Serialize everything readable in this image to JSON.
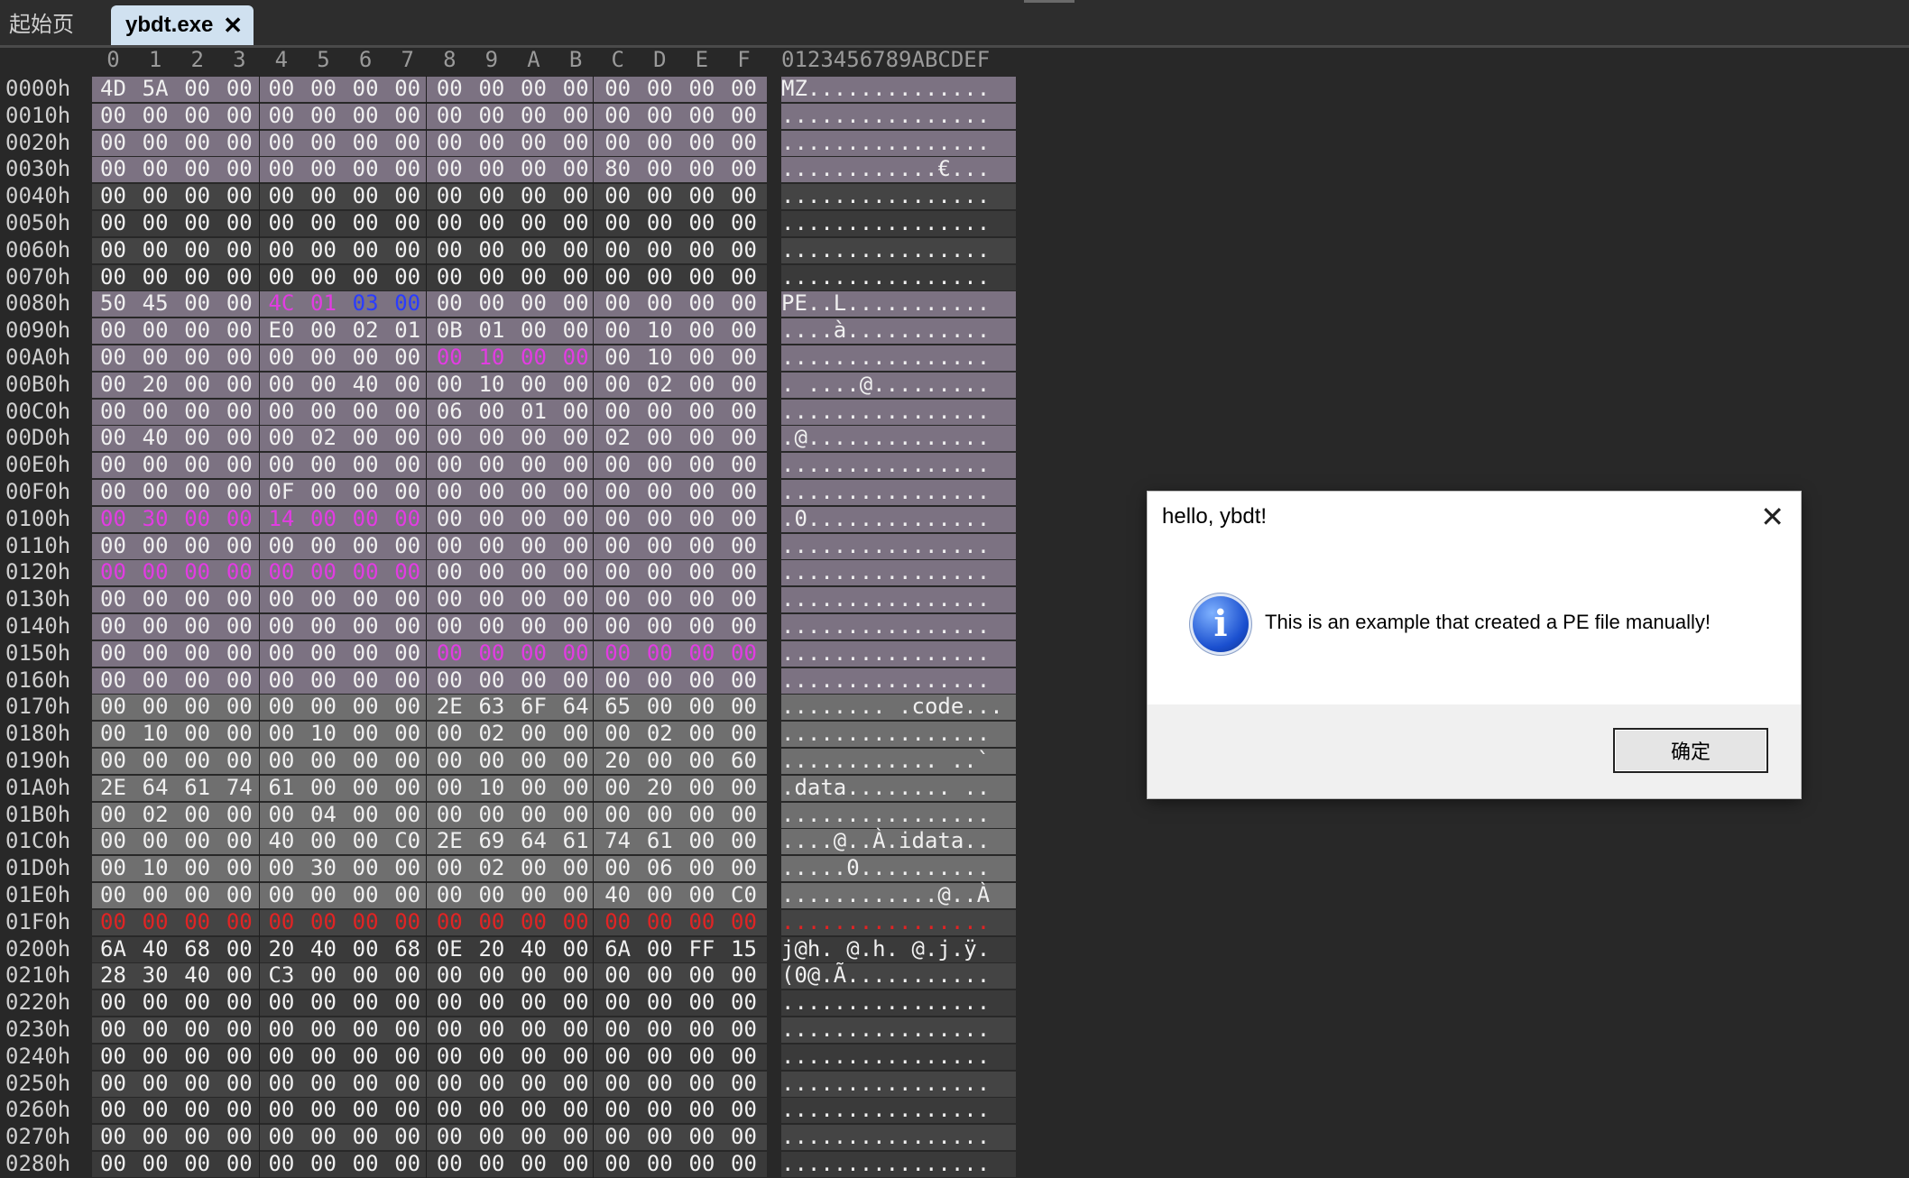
{
  "tabs": {
    "home": "起始页",
    "active": "ybdt.exe",
    "close": "✕"
  },
  "header": {
    "columns": [
      "0",
      "1",
      "2",
      "3",
      "4",
      "5",
      "6",
      "7",
      "8",
      "9",
      "A",
      "B",
      "C",
      "D",
      "E",
      "F"
    ],
    "ascii": "0123456789ABCDEF"
  },
  "rows": [
    {
      "offset": "0000h",
      "hex": [
        "4D",
        "5A",
        "00",
        "00",
        "00",
        "00",
        "00",
        "00",
        "00",
        "00",
        "00",
        "00",
        "00",
        "00",
        "00",
        "00"
      ],
      "ascii": "MZ.............."
    },
    {
      "offset": "0010h",
      "hex": [
        "00",
        "00",
        "00",
        "00",
        "00",
        "00",
        "00",
        "00",
        "00",
        "00",
        "00",
        "00",
        "00",
        "00",
        "00",
        "00"
      ],
      "ascii": "................"
    },
    {
      "offset": "0020h",
      "hex": [
        "00",
        "00",
        "00",
        "00",
        "00",
        "00",
        "00",
        "00",
        "00",
        "00",
        "00",
        "00",
        "00",
        "00",
        "00",
        "00"
      ],
      "ascii": "................"
    },
    {
      "offset": "0030h",
      "hex": [
        "00",
        "00",
        "00",
        "00",
        "00",
        "00",
        "00",
        "00",
        "00",
        "00",
        "00",
        "00",
        "80",
        "00",
        "00",
        "00"
      ],
      "ascii": "............€..."
    },
    {
      "offset": "0040h",
      "hex": [
        "00",
        "00",
        "00",
        "00",
        "00",
        "00",
        "00",
        "00",
        "00",
        "00",
        "00",
        "00",
        "00",
        "00",
        "00",
        "00"
      ],
      "ascii": "................"
    },
    {
      "offset": "0050h",
      "hex": [
        "00",
        "00",
        "00",
        "00",
        "00",
        "00",
        "00",
        "00",
        "00",
        "00",
        "00",
        "00",
        "00",
        "00",
        "00",
        "00"
      ],
      "ascii": "................"
    },
    {
      "offset": "0060h",
      "hex": [
        "00",
        "00",
        "00",
        "00",
        "00",
        "00",
        "00",
        "00",
        "00",
        "00",
        "00",
        "00",
        "00",
        "00",
        "00",
        "00"
      ],
      "ascii": "................"
    },
    {
      "offset": "0070h",
      "hex": [
        "00",
        "00",
        "00",
        "00",
        "00",
        "00",
        "00",
        "00",
        "00",
        "00",
        "00",
        "00",
        "00",
        "00",
        "00",
        "00"
      ],
      "ascii": "................"
    },
    {
      "offset": "0080h",
      "hex": [
        "50",
        "45",
        "00",
        "00",
        "4C",
        "01",
        "03",
        "00",
        "00",
        "00",
        "00",
        "00",
        "00",
        "00",
        "00",
        "00"
      ],
      "ascii": "PE..L..........."
    },
    {
      "offset": "0090h",
      "hex": [
        "00",
        "00",
        "00",
        "00",
        "E0",
        "00",
        "02",
        "01",
        "0B",
        "01",
        "00",
        "00",
        "00",
        "10",
        "00",
        "00"
      ],
      "ascii": "....à..........."
    },
    {
      "offset": "00A0h",
      "hex": [
        "00",
        "00",
        "00",
        "00",
        "00",
        "00",
        "00",
        "00",
        "00",
        "10",
        "00",
        "00",
        "00",
        "10",
        "00",
        "00"
      ],
      "ascii": "................"
    },
    {
      "offset": "00B0h",
      "hex": [
        "00",
        "20",
        "00",
        "00",
        "00",
        "00",
        "40",
        "00",
        "00",
        "10",
        "00",
        "00",
        "00",
        "02",
        "00",
        "00"
      ],
      "ascii": ". ....@........."
    },
    {
      "offset": "00C0h",
      "hex": [
        "00",
        "00",
        "00",
        "00",
        "00",
        "00",
        "00",
        "00",
        "06",
        "00",
        "01",
        "00",
        "00",
        "00",
        "00",
        "00"
      ],
      "ascii": "................"
    },
    {
      "offset": "00D0h",
      "hex": [
        "00",
        "40",
        "00",
        "00",
        "00",
        "02",
        "00",
        "00",
        "00",
        "00",
        "00",
        "00",
        "02",
        "00",
        "00",
        "00"
      ],
      "ascii": ".@.............."
    },
    {
      "offset": "00E0h",
      "hex": [
        "00",
        "00",
        "00",
        "00",
        "00",
        "00",
        "00",
        "00",
        "00",
        "00",
        "00",
        "00",
        "00",
        "00",
        "00",
        "00"
      ],
      "ascii": "................"
    },
    {
      "offset": "00F0h",
      "hex": [
        "00",
        "00",
        "00",
        "00",
        "0F",
        "00",
        "00",
        "00",
        "00",
        "00",
        "00",
        "00",
        "00",
        "00",
        "00",
        "00"
      ],
      "ascii": "................"
    },
    {
      "offset": "0100h",
      "hex": [
        "00",
        "30",
        "00",
        "00",
        "14",
        "00",
        "00",
        "00",
        "00",
        "00",
        "00",
        "00",
        "00",
        "00",
        "00",
        "00"
      ],
      "ascii": ".0.............."
    },
    {
      "offset": "0110h",
      "hex": [
        "00",
        "00",
        "00",
        "00",
        "00",
        "00",
        "00",
        "00",
        "00",
        "00",
        "00",
        "00",
        "00",
        "00",
        "00",
        "00"
      ],
      "ascii": "................"
    },
    {
      "offset": "0120h",
      "hex": [
        "00",
        "00",
        "00",
        "00",
        "00",
        "00",
        "00",
        "00",
        "00",
        "00",
        "00",
        "00",
        "00",
        "00",
        "00",
        "00"
      ],
      "ascii": "................"
    },
    {
      "offset": "0130h",
      "hex": [
        "00",
        "00",
        "00",
        "00",
        "00",
        "00",
        "00",
        "00",
        "00",
        "00",
        "00",
        "00",
        "00",
        "00",
        "00",
        "00"
      ],
      "ascii": "................"
    },
    {
      "offset": "0140h",
      "hex": [
        "00",
        "00",
        "00",
        "00",
        "00",
        "00",
        "00",
        "00",
        "00",
        "00",
        "00",
        "00",
        "00",
        "00",
        "00",
        "00"
      ],
      "ascii": "................"
    },
    {
      "offset": "0150h",
      "hex": [
        "00",
        "00",
        "00",
        "00",
        "00",
        "00",
        "00",
        "00",
        "00",
        "00",
        "00",
        "00",
        "00",
        "00",
        "00",
        "00"
      ],
      "ascii": "................"
    },
    {
      "offset": "0160h",
      "hex": [
        "00",
        "00",
        "00",
        "00",
        "00",
        "00",
        "00",
        "00",
        "00",
        "00",
        "00",
        "00",
        "00",
        "00",
        "00",
        "00"
      ],
      "ascii": "................"
    },
    {
      "offset": "0170h",
      "hex": [
        "00",
        "00",
        "00",
        "00",
        "00",
        "00",
        "00",
        "00",
        "2E",
        "63",
        "6F",
        "64",
        "65",
        "00",
        "00",
        "00"
      ],
      "ascii": "........ .code..."
    },
    {
      "offset": "0180h",
      "hex": [
        "00",
        "10",
        "00",
        "00",
        "00",
        "10",
        "00",
        "00",
        "00",
        "02",
        "00",
        "00",
        "00",
        "02",
        "00",
        "00"
      ],
      "ascii": "................"
    },
    {
      "offset": "0190h",
      "hex": [
        "00",
        "00",
        "00",
        "00",
        "00",
        "00",
        "00",
        "00",
        "00",
        "00",
        "00",
        "00",
        "20",
        "00",
        "00",
        "60"
      ],
      "ascii": "............ ..`"
    },
    {
      "offset": "01A0h",
      "hex": [
        "2E",
        "64",
        "61",
        "74",
        "61",
        "00",
        "00",
        "00",
        "00",
        "10",
        "00",
        "00",
        "00",
        "20",
        "00",
        "00"
      ],
      "ascii": ".data........ .."
    },
    {
      "offset": "01B0h",
      "hex": [
        "00",
        "02",
        "00",
        "00",
        "00",
        "04",
        "00",
        "00",
        "00",
        "00",
        "00",
        "00",
        "00",
        "00",
        "00",
        "00"
      ],
      "ascii": "................"
    },
    {
      "offset": "01C0h",
      "hex": [
        "00",
        "00",
        "00",
        "00",
        "40",
        "00",
        "00",
        "C0",
        "2E",
        "69",
        "64",
        "61",
        "74",
        "61",
        "00",
        "00"
      ],
      "ascii": "....@..À.idata.."
    },
    {
      "offset": "01D0h",
      "hex": [
        "00",
        "10",
        "00",
        "00",
        "00",
        "30",
        "00",
        "00",
        "00",
        "02",
        "00",
        "00",
        "00",
        "06",
        "00",
        "00"
      ],
      "ascii": ".....0.........."
    },
    {
      "offset": "01E0h",
      "hex": [
        "00",
        "00",
        "00",
        "00",
        "00",
        "00",
        "00",
        "00",
        "00",
        "00",
        "00",
        "00",
        "40",
        "00",
        "00",
        "C0"
      ],
      "ascii": "............@..À"
    },
    {
      "offset": "01F0h",
      "hex": [
        "00",
        "00",
        "00",
        "00",
        "00",
        "00",
        "00",
        "00",
        "00",
        "00",
        "00",
        "00",
        "00",
        "00",
        "00",
        "00"
      ],
      "ascii": "................"
    },
    {
      "offset": "0200h",
      "hex": [
        "6A",
        "40",
        "68",
        "00",
        "20",
        "40",
        "00",
        "68",
        "0E",
        "20",
        "40",
        "00",
        "6A",
        "00",
        "FF",
        "15"
      ],
      "ascii": "j@h. @.h. @.j.ÿ."
    },
    {
      "offset": "0210h",
      "hex": [
        "28",
        "30",
        "40",
        "00",
        "C3",
        "00",
        "00",
        "00",
        "00",
        "00",
        "00",
        "00",
        "00",
        "00",
        "00",
        "00"
      ],
      "ascii": "(0@.Ã..........."
    },
    {
      "offset": "0220h",
      "hex": [
        "00",
        "00",
        "00",
        "00",
        "00",
        "00",
        "00",
        "00",
        "00",
        "00",
        "00",
        "00",
        "00",
        "00",
        "00",
        "00"
      ],
      "ascii": "................"
    },
    {
      "offset": "0230h",
      "hex": [
        "00",
        "00",
        "00",
        "00",
        "00",
        "00",
        "00",
        "00",
        "00",
        "00",
        "00",
        "00",
        "00",
        "00",
        "00",
        "00"
      ],
      "ascii": "................"
    },
    {
      "offset": "0240h",
      "hex": [
        "00",
        "00",
        "00",
        "00",
        "00",
        "00",
        "00",
        "00",
        "00",
        "00",
        "00",
        "00",
        "00",
        "00",
        "00",
        "00"
      ],
      "ascii": "................"
    },
    {
      "offset": "0250h",
      "hex": [
        "00",
        "00",
        "00",
        "00",
        "00",
        "00",
        "00",
        "00",
        "00",
        "00",
        "00",
        "00",
        "00",
        "00",
        "00",
        "00"
      ],
      "ascii": "................"
    },
    {
      "offset": "0260h",
      "hex": [
        "00",
        "00",
        "00",
        "00",
        "00",
        "00",
        "00",
        "00",
        "00",
        "00",
        "00",
        "00",
        "00",
        "00",
        "00",
        "00"
      ],
      "ascii": "................"
    },
    {
      "offset": "0270h",
      "hex": [
        "00",
        "00",
        "00",
        "00",
        "00",
        "00",
        "00",
        "00",
        "00",
        "00",
        "00",
        "00",
        "00",
        "00",
        "00",
        "00"
      ],
      "ascii": "................"
    },
    {
      "offset": "0280h",
      "hex": [
        "00",
        "00",
        "00",
        "00",
        "00",
        "00",
        "00",
        "00",
        "00",
        "00",
        "00",
        "00",
        "00",
        "00",
        "00",
        "00"
      ],
      "ascii": "................"
    }
  ],
  "dialog": {
    "title": "hello, ybdt!",
    "close": "✕",
    "icon": "info-icon",
    "message": "This is an example that created a PE file manually!",
    "ok": "确定"
  },
  "colors": {
    "background": "#282828",
    "selection_purple": "#7c7282",
    "selection_gray": "#6f6f6f",
    "magenta": "#e23ce2",
    "blue": "#2a3cff",
    "red": "#e02424",
    "active_tab": "#d0e1f0"
  }
}
